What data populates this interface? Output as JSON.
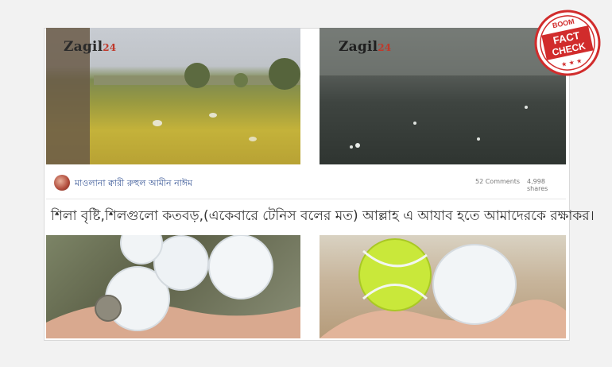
{
  "watermark": {
    "brand": "Zagil",
    "num": "24"
  },
  "post": {
    "author": "মাওলানা ক্বারী রুহুল আমীন নাঈম",
    "comments": "52 Comments",
    "shares": "4,998 shares",
    "caption": "শিলা বৃষ্টি,শিলগুলো কতবড়,(একেবারে টেনিস বলের মত) আল্লাহ এ আযাব হতে আমাদেরকে রক্ষাকর।"
  },
  "stamp": {
    "brand": "BOOM",
    "line1": "FACT",
    "line2": "CHECK",
    "color": "#d12c2c"
  }
}
